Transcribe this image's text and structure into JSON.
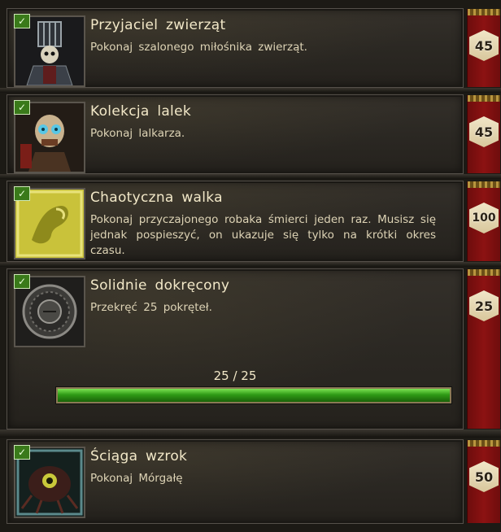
{
  "achievements": [
    {
      "title": "Przyjaciel zwierząt",
      "description": "Pokonaj szalonego miłośnika zwierząt.",
      "points": "45",
      "icon": "caged-skeleton-icon",
      "completed": true
    },
    {
      "title": "Kolekcja lalek",
      "description": "Pokonaj lalkarza.",
      "points": "45",
      "icon": "dollmaker-skull-icon",
      "completed": true
    },
    {
      "title": "Chaotyczna walka",
      "description": "Pokonaj przyczajonego robaka śmierci jeden raz. Musisz się jednak pospieszyć, on ukazuje się tylko na krótki okres czasu.",
      "points": "100",
      "icon": "death-worm-icon",
      "completed": true
    },
    {
      "title": "Solidnie dokręcony",
      "description": "Przekręć 25 pokręteł.",
      "points": "25",
      "icon": "crank-wheel-icon",
      "completed": true,
      "progress": {
        "text": "25 / 25",
        "fraction": 1.0
      }
    },
    {
      "title": "Ściąga wzrok",
      "description": "Pokonaj Mórgałę",
      "points": "50",
      "icon": "eye-monster-icon",
      "completed": true
    }
  ],
  "colors": {
    "ribbon": "#8c1212",
    "checkmark": "#3a7a1a",
    "progress_fill": "#2f9a16"
  }
}
